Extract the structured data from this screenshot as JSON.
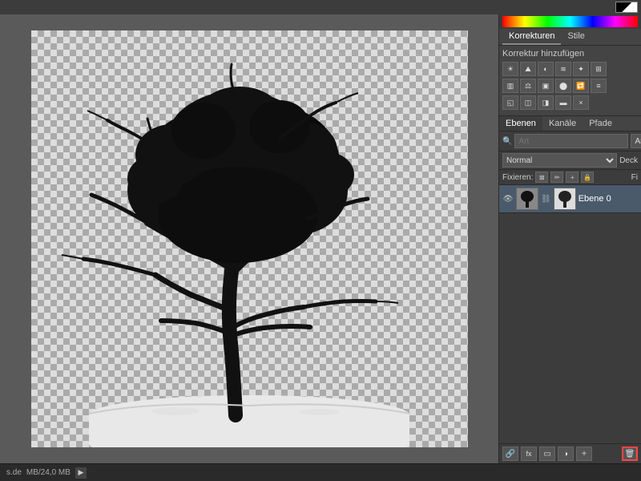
{
  "topbar": {
    "color_swatch_label": "color swatch"
  },
  "corrections_panel": {
    "tabs": [
      {
        "label": "Korrekturen",
        "active": true
      },
      {
        "label": "Stile",
        "active": false
      }
    ],
    "title": "Korrektur hinzufügen",
    "icons_row1": [
      "☀",
      "⛰",
      "◐",
      "≋",
      "✦",
      "⊞"
    ],
    "icons_row2": [
      "▥",
      "⚖",
      "▣",
      "⬤",
      "🔁",
      "≡"
    ],
    "icons_row3": [
      "◱",
      "◫",
      "◨",
      "▬",
      "x"
    ]
  },
  "layers_panel": {
    "tabs": [
      {
        "label": "Ebenen",
        "active": true
      },
      {
        "label": "Kanäle",
        "active": false
      },
      {
        "label": "Pfade",
        "active": false
      }
    ],
    "search_placeholder": "Art",
    "blend_mode": "Normal",
    "opacity_label": "Deck",
    "fix_label": "Fixieren:",
    "fill_label": "Fi",
    "layer": {
      "name": "Ebene 0",
      "visible": true
    }
  },
  "bottom_bar": {
    "info": "s.de",
    "file_size": "MB/24,0 MB"
  },
  "layers_bottom_buttons": [
    "🔗",
    "fx",
    "🔲",
    "🗑"
  ],
  "canvas": {
    "alt_text": "Tree on snow background"
  }
}
